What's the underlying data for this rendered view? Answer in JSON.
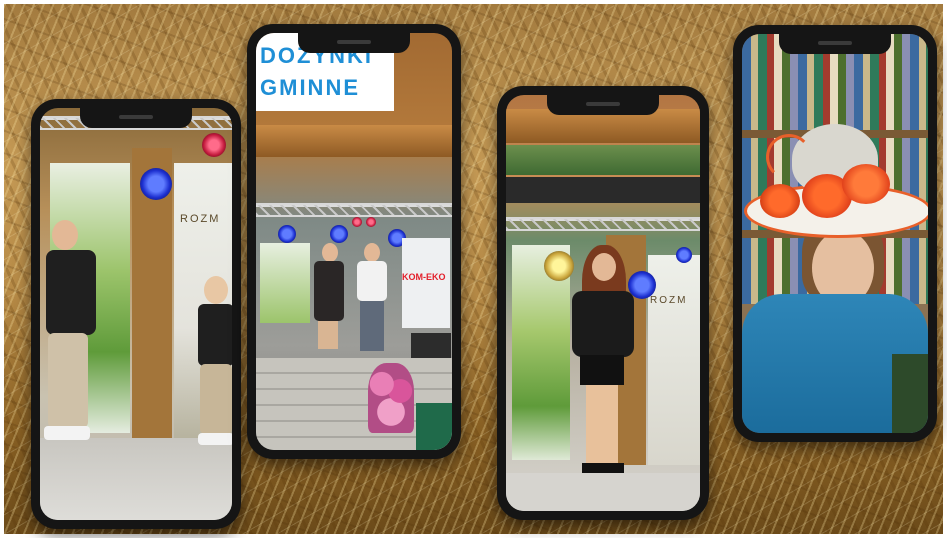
{
  "banner": {
    "line1": "DOZYNKI",
    "line2": "GMINNE"
  },
  "logos": {
    "rozmo": "ROZM",
    "kom_eko": "KOM-EKO"
  }
}
